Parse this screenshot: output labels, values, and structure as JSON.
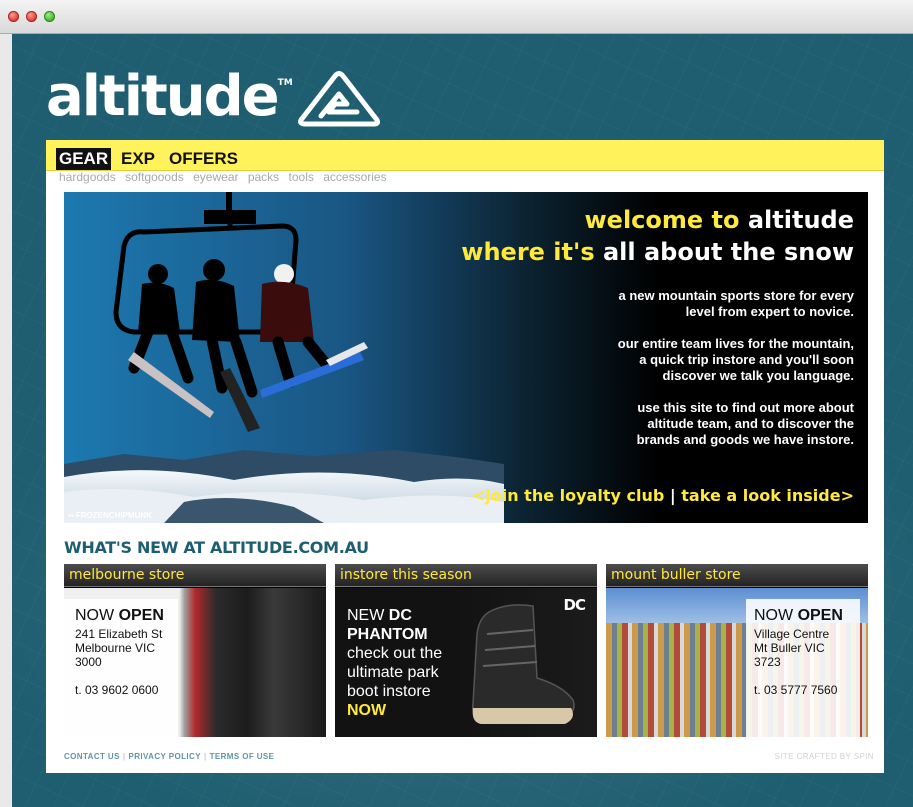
{
  "colors": {
    "accent_yellow": "#ffe93b",
    "nav_yellow": "#fff25a",
    "background_teal": "#1e5e70",
    "title_teal": "#1d5e70"
  },
  "logo": {
    "text": "altitude",
    "tm": "TM"
  },
  "nav": {
    "items": [
      {
        "label": "GEAR",
        "active": true
      },
      {
        "label": "EXP"
      },
      {
        "label": "OFFERS"
      }
    ],
    "subitems": [
      "hardgoods",
      "softgooods",
      "eyewear",
      "packs",
      "tools",
      "accessories"
    ]
  },
  "hero": {
    "line1_yellow": "welcome to",
    "line1_white": "altitude",
    "line2_yellow": "where it's",
    "line2_white": "all about the snow",
    "p1": "a new mountain sports store for every\nlevel from expert to novice.",
    "p2": "our entire team lives for the mountain,\na quick trip instore and you'll soon\ndiscover we talk you language.",
    "p3": "use this site to find out more about\naltitude team, and to discover the\nbrands and goods we have instore.",
    "cta_join": "<join the loyalty club",
    "cta_sep": "|",
    "cta_look": "take a look inside>",
    "photo_credit": "FROZENCHIPMUNK"
  },
  "whats_new": {
    "title": "WHAT'S NEW AT ALTITUDE.COM.AU"
  },
  "cards": {
    "melbourne": {
      "title": "melbourne store",
      "now": "NOW",
      "open": "OPEN",
      "address": "241 Elizabeth St\nMelbourne VIC\n3000",
      "phone": "t. 03 9602 0600"
    },
    "instore": {
      "title": "instore this season",
      "new": "NEW",
      "brand": "DC",
      "product": "PHANTOM",
      "copy1": "check out the",
      "copy2": "ultimate park",
      "copy3": "boot instore",
      "now": "NOW"
    },
    "buller": {
      "title": "mount buller store",
      "now": "NOW",
      "open": "OPEN",
      "address": "Village Centre\nMt Buller VIC\n3723",
      "phone": "t. 03 5777 7560"
    }
  },
  "footer": {
    "contact": "CONTACT US",
    "privacy": "PRIVACY POLICY",
    "terms": "TERMS OF USE",
    "credit": "SITE CRAFTED BY SPIN"
  }
}
